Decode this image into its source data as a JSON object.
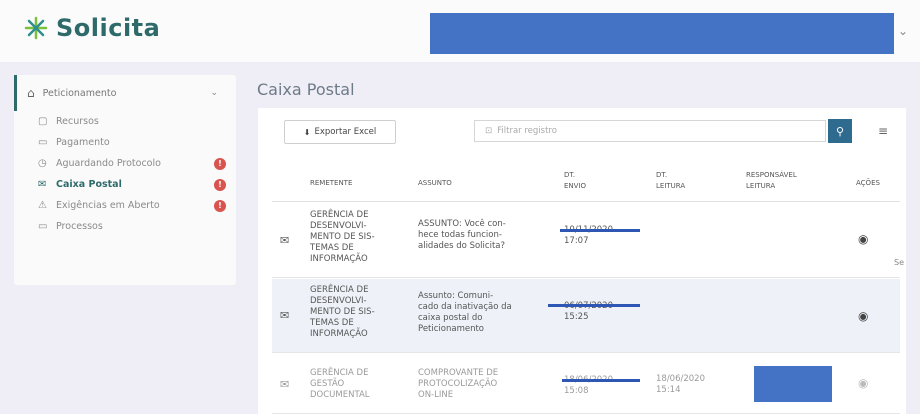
{
  "app": {
    "name": "Solicita"
  },
  "colors": {
    "brand": "#2f6a6a",
    "redaction": "#4472c4",
    "danger": "#d9534f",
    "strike": "#2e57b5"
  },
  "sidebar": {
    "header": {
      "label": "Peticionamento",
      "icon": "home-icon"
    },
    "items": [
      {
        "label": "Recursos",
        "icon": "document-icon",
        "badge": ""
      },
      {
        "label": "Pagamento",
        "icon": "card-icon",
        "badge": ""
      },
      {
        "label": "Aguardando Protocolo",
        "icon": "clock-icon",
        "badge": "!"
      },
      {
        "label": "Caixa Postal",
        "icon": "inbox-icon",
        "badge": "!"
      },
      {
        "label": "Exigências em Aberto",
        "icon": "alert-icon",
        "badge": "!"
      },
      {
        "label": "Processos",
        "icon": "folder-icon",
        "badge": ""
      }
    ]
  },
  "page": {
    "title": "Caixa Postal"
  },
  "toolbar": {
    "export_label": "Exportar Excel",
    "search_placeholder": "Filtrar registro"
  },
  "table": {
    "headers": {
      "remetente": "REMETENTE",
      "assunto": "ASSUNTO",
      "envio": "DT.\nENVIO",
      "leitura": "DT.\nLEITURA",
      "responsavel": "RESPONSÁVEL\nLEITURA",
      "acoes": "AÇÕES"
    },
    "rows": [
      {
        "remetente": "GERÊNCIA DE\nDESENVOLVI-\nMENTO DE SIS-\nTEMAS DE\nINFORMAÇÃO",
        "assunto": "ASSUNTO: Você con-\nhece todas funcion-\nalidades do Solicita?",
        "envio_date": "10/11/2020",
        "envio_time": "17:07",
        "leitura": ""
      },
      {
        "remetente": "GERÊNCIA DE\nDESENVOLVI-\nMENTO DE SIS-\nTEMAS DE\nINFORMAÇÃO",
        "assunto": "Assunto: Comuni-\ncado da inativação da\ncaixa postal do\nPeticionamento",
        "envio_date": "06/07/2020",
        "envio_time": "15:25",
        "leitura": ""
      },
      {
        "remetente": "GERÊNCIA DE\nGESTÃO\nDOCUMENTAL",
        "assunto": "COMPROVANTE DE\nPROTOCOLIZAÇÃO\nON-LINE",
        "envio_date": "18/06/2020",
        "envio_time": "15:08",
        "leitura": "18/06/2020\n15:14"
      }
    ]
  },
  "side_note": "Se"
}
